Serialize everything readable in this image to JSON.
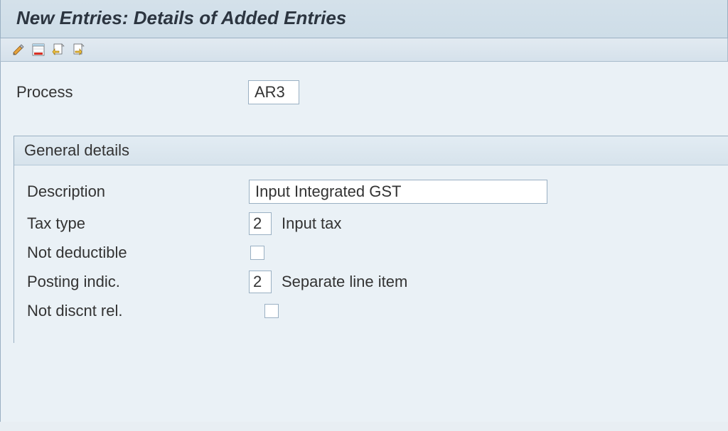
{
  "title": "New Entries: Details of Added Entries",
  "toolbar": {
    "edit_icon": "edit-pencil-icon",
    "delete_icon": "delete-row-icon",
    "prev_icon": "previous-entry-icon",
    "next_icon": "next-entry-icon"
  },
  "process": {
    "label": "Process",
    "value": "AR3"
  },
  "general": {
    "title": "General details",
    "description_label": "Description",
    "description_value": "Input Integrated GST",
    "tax_type_label": "Tax type",
    "tax_type_value": "2",
    "tax_type_desc": "Input tax",
    "not_deductible_label": "Not deductible",
    "not_deductible_checked": false,
    "posting_indic_label": "Posting indic.",
    "posting_indic_value": "2",
    "posting_indic_desc": "Separate line item",
    "not_discnt_label": "Not discnt rel.",
    "not_discnt_checked": false
  }
}
